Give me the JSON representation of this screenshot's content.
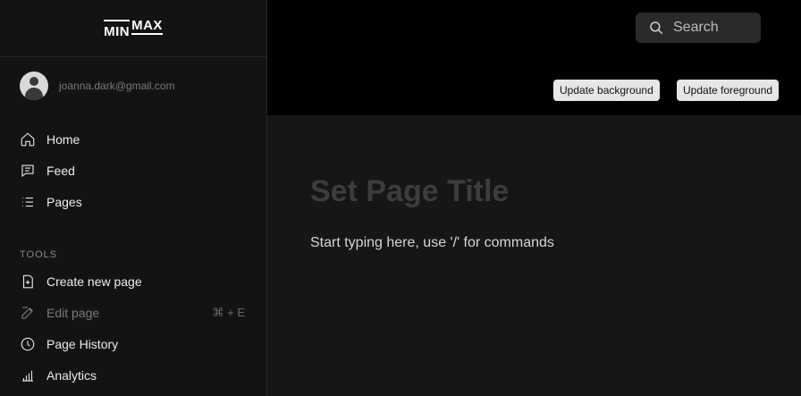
{
  "app": {
    "logo_min": "MIN",
    "logo_max": "MAX"
  },
  "user": {
    "email": "joanna.dark@gmail.com"
  },
  "nav": {
    "items": [
      {
        "label": "Home",
        "icon": "home-icon"
      },
      {
        "label": "Feed",
        "icon": "feed-icon"
      },
      {
        "label": "Pages",
        "icon": "list-icon"
      }
    ]
  },
  "tools": {
    "section_label": "TOOLS",
    "items": [
      {
        "label": "Create new page",
        "icon": "new-page-icon"
      },
      {
        "label": "Edit page",
        "icon": "edit-icon",
        "shortcut": "⌘ + E",
        "disabled": true
      },
      {
        "label": "Page History",
        "icon": "history-icon"
      },
      {
        "label": "Analytics",
        "icon": "analytics-icon"
      }
    ]
  },
  "header": {
    "search_placeholder": "Search",
    "update_background_label": "Update background",
    "update_foreground_label": "Update foreground"
  },
  "editor": {
    "title_placeholder": "Set Page Title",
    "body_placeholder": "Start typing here, use '/' for commands"
  },
  "colors": {
    "sidebar_bg": "#131313",
    "topbar_bg": "#000000",
    "editor_bg": "#161616",
    "button_bg": "#e6e6e6"
  }
}
